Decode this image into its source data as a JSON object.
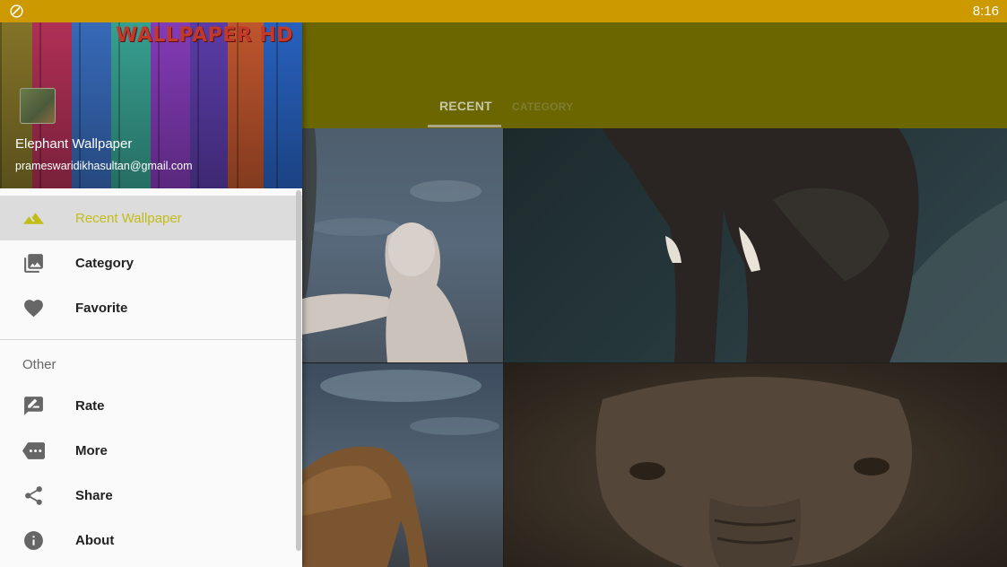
{
  "status_bar": {
    "time": "8:16"
  },
  "app": {
    "tabs": [
      {
        "label": "RECENT",
        "selected": true
      },
      {
        "label": "CATEGORY",
        "selected": false
      }
    ]
  },
  "drawer": {
    "header": {
      "brand": "WALLPAPER HD",
      "app_name": "Elephant Wallpaper",
      "email": "prameswaridikhasultan@gmail.com"
    },
    "menu": [
      {
        "label": "Recent Wallpaper",
        "icon": "landscape-icon",
        "active": true
      },
      {
        "label": "Category",
        "icon": "photo-library-icon",
        "active": false
      },
      {
        "label": "Favorite",
        "icon": "heart-icon",
        "active": false
      }
    ],
    "section_other": "Other",
    "other_menu": [
      {
        "label": "Rate",
        "icon": "rate-review-icon"
      },
      {
        "label": "More",
        "icon": "more-icon"
      },
      {
        "label": "Share",
        "icon": "share-icon"
      },
      {
        "label": "About",
        "icon": "info-icon"
      }
    ]
  },
  "colors": {
    "status_bar": "#cc9900",
    "app_bar": "#6b6600",
    "active_accent": "#c2bd16"
  }
}
